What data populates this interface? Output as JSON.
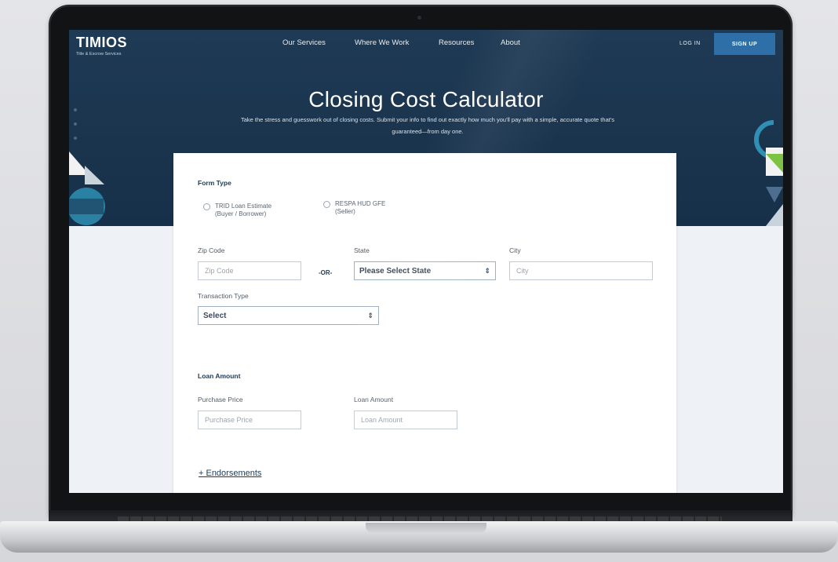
{
  "site": {
    "logo_text": "TIMIOS",
    "logo_tagline": "Title & Escrow Services",
    "nav": [
      "Our Services",
      "Where We Work",
      "Resources",
      "About"
    ],
    "login_label": "LOG IN",
    "signup_label": "SIGN UP"
  },
  "hero": {
    "title": "Closing Cost Calculator",
    "subtitle": "Take the stress and guesswork out of closing costs. Submit your info to find out exactly how much you'll pay with a simple, accurate quote that's guaranteed—from day one."
  },
  "form": {
    "form_type_label": "Form Type",
    "radio_options": [
      {
        "line1": "TRID Loan Estimate",
        "line2": "(Buyer / Borrower)"
      },
      {
        "line1": "RESPA HUD GFE",
        "line2": "(Seller)"
      }
    ],
    "zip": {
      "label": "Zip Code",
      "placeholder": "Zip Code"
    },
    "or_label": "-OR-",
    "state": {
      "label": "State",
      "value": "Please Select State"
    },
    "city": {
      "label": "City",
      "placeholder": "City"
    },
    "transaction": {
      "label": "Transaction Type",
      "value": "Select"
    },
    "loan_section_label": "Loan Amount",
    "purchase_price": {
      "label": "Purchase Price",
      "placeholder": "Purchase Price"
    },
    "loan_amount": {
      "label": "Loan Amount",
      "placeholder": "Loan Amount"
    },
    "endorsements_link": "+ Endorsements"
  },
  "icons": {
    "select_arrow": "select-arrows-icon",
    "radio": "radio-circle-icon"
  },
  "colors": {
    "navy": "#1f3a55",
    "accent_blue": "#2d6fa6",
    "green": "#7cc243",
    "teal": "#2f8fb4"
  }
}
